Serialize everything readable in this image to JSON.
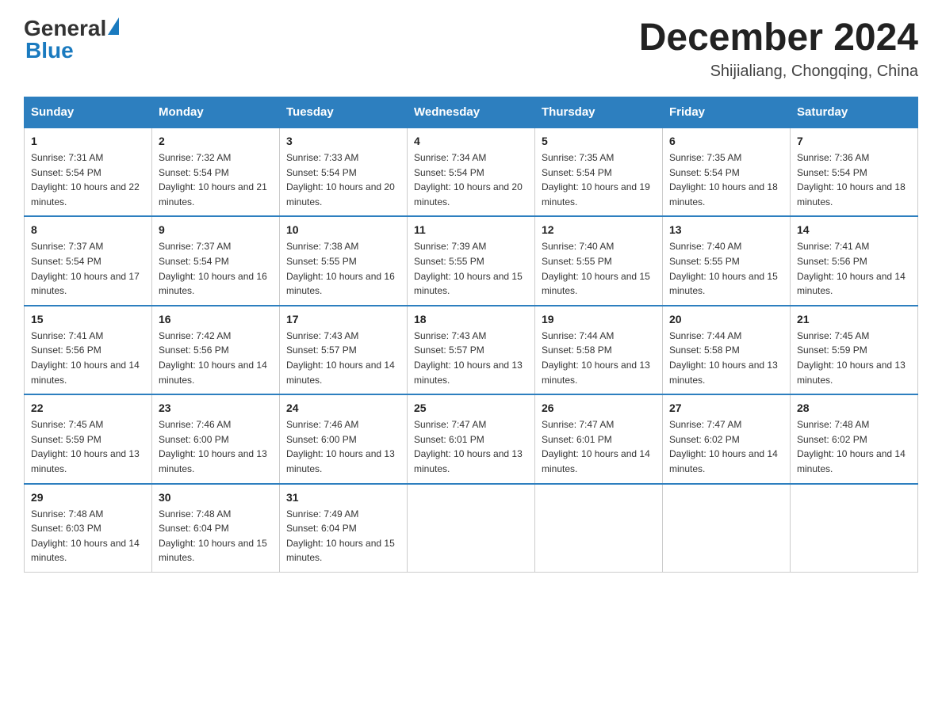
{
  "header": {
    "logo_general": "General",
    "logo_blue": "Blue",
    "month_title": "December 2024",
    "location": "Shijialiang, Chongqing, China"
  },
  "days_of_week": [
    "Sunday",
    "Monday",
    "Tuesday",
    "Wednesday",
    "Thursday",
    "Friday",
    "Saturday"
  ],
  "weeks": [
    [
      {
        "day": "1",
        "sunrise": "7:31 AM",
        "sunset": "5:54 PM",
        "daylight": "10 hours and 22 minutes."
      },
      {
        "day": "2",
        "sunrise": "7:32 AM",
        "sunset": "5:54 PM",
        "daylight": "10 hours and 21 minutes."
      },
      {
        "day": "3",
        "sunrise": "7:33 AM",
        "sunset": "5:54 PM",
        "daylight": "10 hours and 20 minutes."
      },
      {
        "day": "4",
        "sunrise": "7:34 AM",
        "sunset": "5:54 PM",
        "daylight": "10 hours and 20 minutes."
      },
      {
        "day": "5",
        "sunrise": "7:35 AM",
        "sunset": "5:54 PM",
        "daylight": "10 hours and 19 minutes."
      },
      {
        "day": "6",
        "sunrise": "7:35 AM",
        "sunset": "5:54 PM",
        "daylight": "10 hours and 18 minutes."
      },
      {
        "day": "7",
        "sunrise": "7:36 AM",
        "sunset": "5:54 PM",
        "daylight": "10 hours and 18 minutes."
      }
    ],
    [
      {
        "day": "8",
        "sunrise": "7:37 AM",
        "sunset": "5:54 PM",
        "daylight": "10 hours and 17 minutes."
      },
      {
        "day": "9",
        "sunrise": "7:37 AM",
        "sunset": "5:54 PM",
        "daylight": "10 hours and 16 minutes."
      },
      {
        "day": "10",
        "sunrise": "7:38 AM",
        "sunset": "5:55 PM",
        "daylight": "10 hours and 16 minutes."
      },
      {
        "day": "11",
        "sunrise": "7:39 AM",
        "sunset": "5:55 PM",
        "daylight": "10 hours and 15 minutes."
      },
      {
        "day": "12",
        "sunrise": "7:40 AM",
        "sunset": "5:55 PM",
        "daylight": "10 hours and 15 minutes."
      },
      {
        "day": "13",
        "sunrise": "7:40 AM",
        "sunset": "5:55 PM",
        "daylight": "10 hours and 15 minutes."
      },
      {
        "day": "14",
        "sunrise": "7:41 AM",
        "sunset": "5:56 PM",
        "daylight": "10 hours and 14 minutes."
      }
    ],
    [
      {
        "day": "15",
        "sunrise": "7:41 AM",
        "sunset": "5:56 PM",
        "daylight": "10 hours and 14 minutes."
      },
      {
        "day": "16",
        "sunrise": "7:42 AM",
        "sunset": "5:56 PM",
        "daylight": "10 hours and 14 minutes."
      },
      {
        "day": "17",
        "sunrise": "7:43 AM",
        "sunset": "5:57 PM",
        "daylight": "10 hours and 14 minutes."
      },
      {
        "day": "18",
        "sunrise": "7:43 AM",
        "sunset": "5:57 PM",
        "daylight": "10 hours and 13 minutes."
      },
      {
        "day": "19",
        "sunrise": "7:44 AM",
        "sunset": "5:58 PM",
        "daylight": "10 hours and 13 minutes."
      },
      {
        "day": "20",
        "sunrise": "7:44 AM",
        "sunset": "5:58 PM",
        "daylight": "10 hours and 13 minutes."
      },
      {
        "day": "21",
        "sunrise": "7:45 AM",
        "sunset": "5:59 PM",
        "daylight": "10 hours and 13 minutes."
      }
    ],
    [
      {
        "day": "22",
        "sunrise": "7:45 AM",
        "sunset": "5:59 PM",
        "daylight": "10 hours and 13 minutes."
      },
      {
        "day": "23",
        "sunrise": "7:46 AM",
        "sunset": "6:00 PM",
        "daylight": "10 hours and 13 minutes."
      },
      {
        "day": "24",
        "sunrise": "7:46 AM",
        "sunset": "6:00 PM",
        "daylight": "10 hours and 13 minutes."
      },
      {
        "day": "25",
        "sunrise": "7:47 AM",
        "sunset": "6:01 PM",
        "daylight": "10 hours and 13 minutes."
      },
      {
        "day": "26",
        "sunrise": "7:47 AM",
        "sunset": "6:01 PM",
        "daylight": "10 hours and 14 minutes."
      },
      {
        "day": "27",
        "sunrise": "7:47 AM",
        "sunset": "6:02 PM",
        "daylight": "10 hours and 14 minutes."
      },
      {
        "day": "28",
        "sunrise": "7:48 AM",
        "sunset": "6:02 PM",
        "daylight": "10 hours and 14 minutes."
      }
    ],
    [
      {
        "day": "29",
        "sunrise": "7:48 AM",
        "sunset": "6:03 PM",
        "daylight": "10 hours and 14 minutes."
      },
      {
        "day": "30",
        "sunrise": "7:48 AM",
        "sunset": "6:04 PM",
        "daylight": "10 hours and 15 minutes."
      },
      {
        "day": "31",
        "sunrise": "7:49 AM",
        "sunset": "6:04 PM",
        "daylight": "10 hours and 15 minutes."
      },
      null,
      null,
      null,
      null
    ]
  ]
}
